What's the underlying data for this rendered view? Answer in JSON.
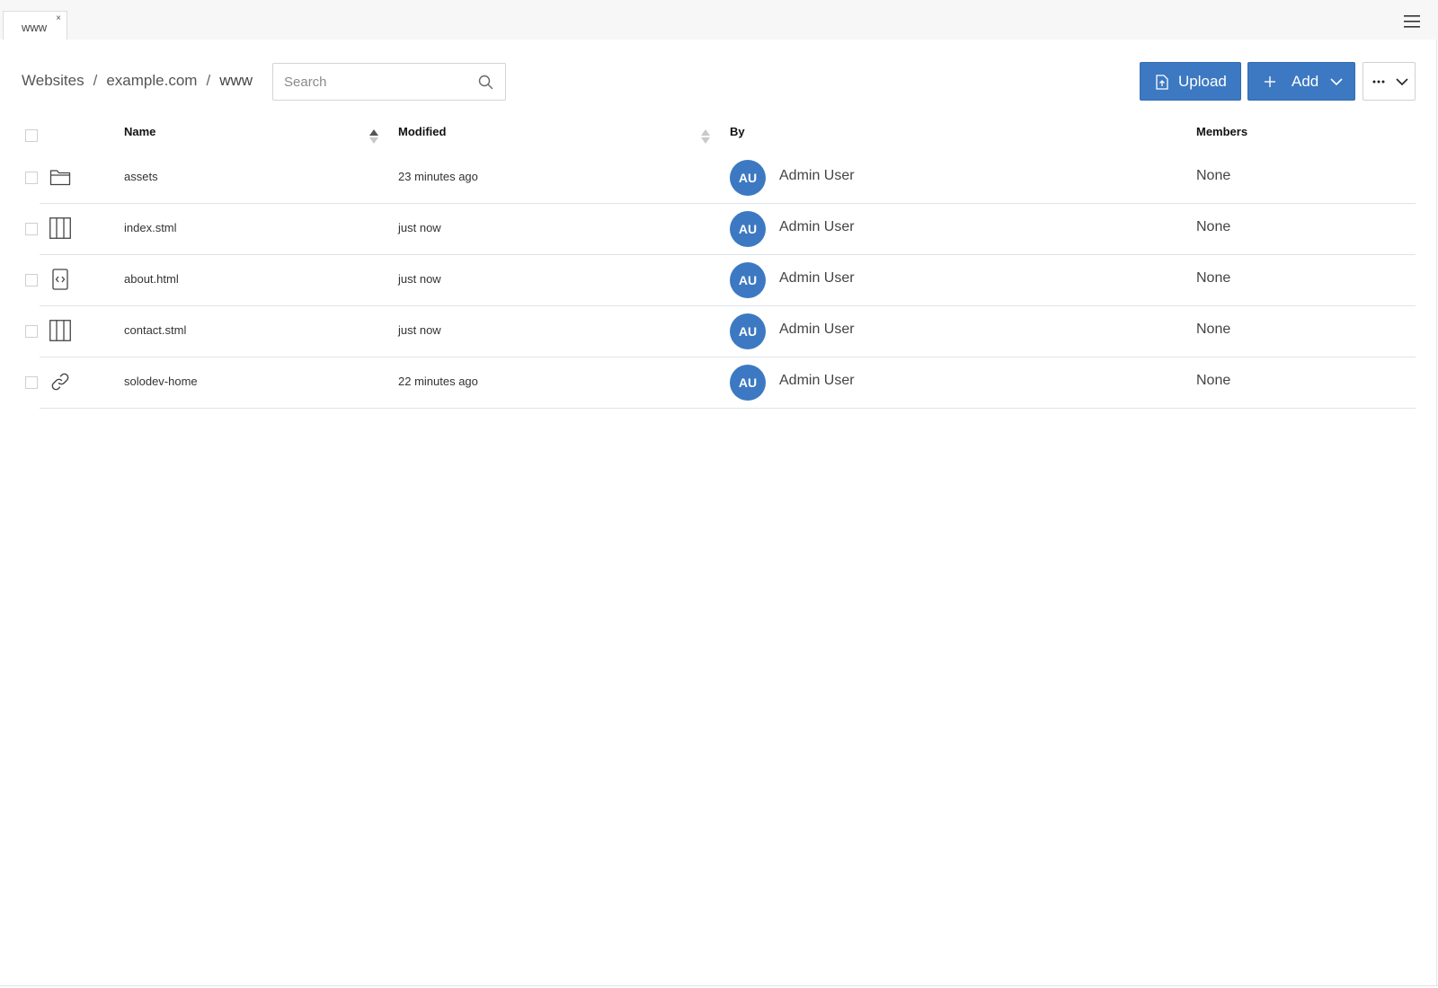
{
  "tabs": [
    {
      "label": "www",
      "close": "×"
    }
  ],
  "breadcrumb": {
    "items": [
      "Websites",
      "example.com",
      "www"
    ],
    "separator": "/"
  },
  "search": {
    "placeholder": "Search",
    "value": ""
  },
  "toolbar": {
    "upload_label": "Upload",
    "add_label": "Add",
    "more_label": "More"
  },
  "table": {
    "columns": {
      "name": "Name",
      "modified": "Modified",
      "by": "By",
      "members": "Members"
    },
    "sort": {
      "column": "name",
      "direction": "ascending"
    },
    "rows": [
      {
        "icon": "folder-icon",
        "name": "assets",
        "modified": "23 minutes ago",
        "avatar": "AU",
        "by": "Admin User",
        "members": "None"
      },
      {
        "icon": "template-icon",
        "name": "index.stml",
        "modified": "just now",
        "avatar": "AU",
        "by": "Admin User",
        "members": "None"
      },
      {
        "icon": "code-file-icon",
        "name": "about.html",
        "modified": "just now",
        "avatar": "AU",
        "by": "Admin User",
        "members": "None"
      },
      {
        "icon": "template-icon",
        "name": "contact.stml",
        "modified": "just now",
        "avatar": "AU",
        "by": "Admin User",
        "members": "None"
      },
      {
        "icon": "link-icon",
        "name": "solodev-home",
        "modified": "22 minutes ago",
        "avatar": "AU",
        "by": "Admin User",
        "members": "None"
      }
    ]
  },
  "colors": {
    "primary": "#3c79c2",
    "row_border": "#dfe3ea",
    "tabbar_bg": "#f7f7f8"
  }
}
